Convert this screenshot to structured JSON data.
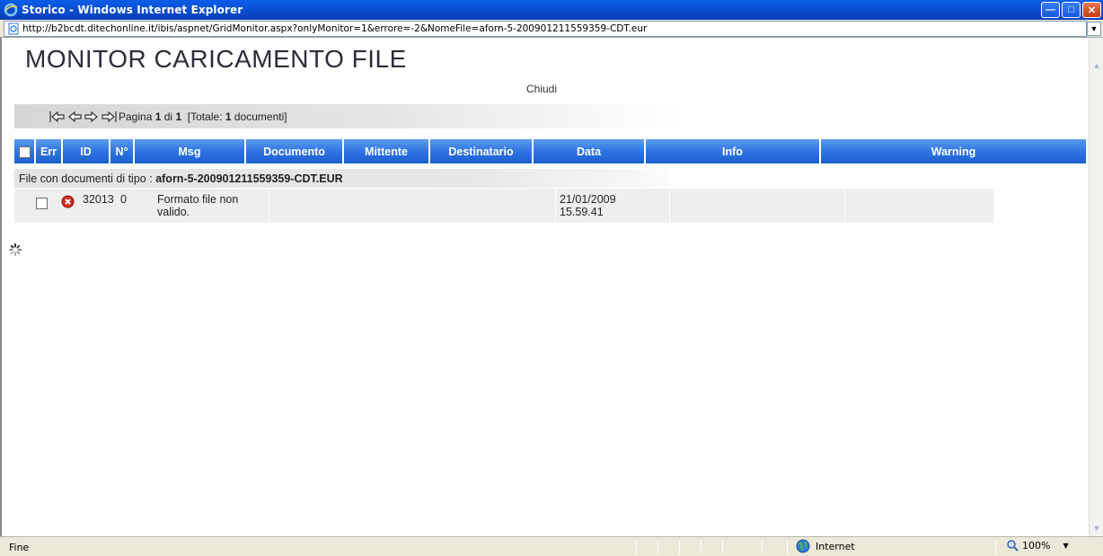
{
  "window": {
    "title": "Storico - Windows Internet Explorer"
  },
  "address": {
    "url": "http://b2bcdt.ditechonline.it/ibis/aspnet/GridMonitor.aspx?onlyMonitor=1&errore=-2&NomeFile=aforn-5-200901211559359-CDT.eur"
  },
  "page": {
    "title": "MONITOR CARICAMENTO FILE",
    "close_label": "Chiudi"
  },
  "pager": {
    "prefix": "Pagina",
    "current": "1",
    "of_label": "di",
    "total_pages": "1",
    "total_prefix": "[Totale:",
    "total_count": "1",
    "total_suffix": "documenti]"
  },
  "grid": {
    "columns": [
      "Err",
      "ID",
      "N°",
      "Msg",
      "Documento",
      "Mittente",
      "Destinatario",
      "Data",
      "Info",
      "Warning"
    ],
    "group": {
      "prefix": "File con documenti di tipo :",
      "name": "aforn-5-200901211559359-CDT.EUR"
    },
    "rows": [
      {
        "id": "32013",
        "num": "0",
        "msg_line1": "Formato file non",
        "msg_line2": "valido.",
        "documento": "",
        "mittente": "",
        "destinatario": "",
        "date_line1": "21/01/2009",
        "date_line2": "15.59.41",
        "info": "",
        "warning": ""
      }
    ]
  },
  "status": {
    "text": "Fine",
    "zone": "Internet",
    "zoom": "100%"
  },
  "colors": {
    "header": "#2f74e2",
    "titlebar": "#0a4fd4",
    "error_icon": "#d62b1f"
  },
  "icons": [
    "ie-logo-icon",
    "page-icon",
    "first-page-icon",
    "prev-page-icon",
    "next-page-icon",
    "last-page-icon",
    "error-icon",
    "loading-spinner-icon",
    "globe-icon",
    "zoom-icon"
  ]
}
